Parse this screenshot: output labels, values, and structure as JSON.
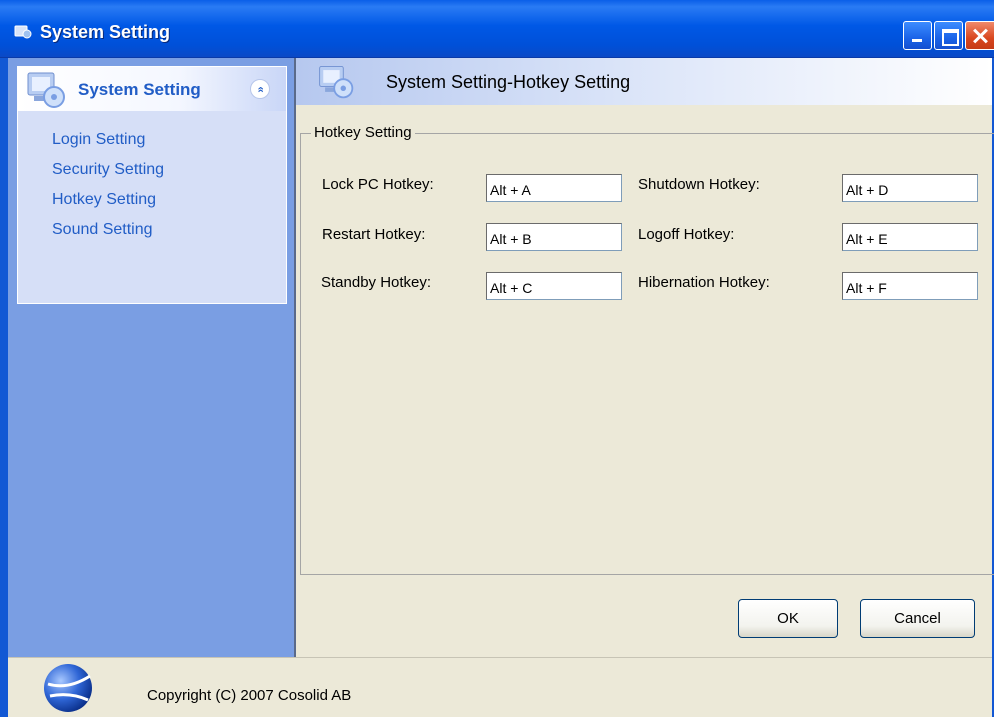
{
  "window": {
    "title": "System Setting",
    "icons": {
      "app": "app-icon",
      "minimize": "minimize-icon",
      "maximize": "maximize-icon",
      "close": "close-icon"
    }
  },
  "sidebar": {
    "header_title": "System Setting",
    "collapse_glyph": "«",
    "items": [
      {
        "label": "Login Setting"
      },
      {
        "label": "Security Setting"
      },
      {
        "label": "Hotkey Setting"
      },
      {
        "label": "Sound Setting"
      }
    ]
  },
  "content": {
    "header_title": "System Setting-Hotkey Setting",
    "group_title": "Hotkey Setting",
    "fields": {
      "lock_pc": {
        "label": "Lock PC Hotkey:",
        "value": "Alt + A"
      },
      "restart": {
        "label": "Restart Hotkey:",
        "value": "Alt + B"
      },
      "standby": {
        "label": "Standby Hotkey:",
        "value": "Alt + C"
      },
      "shutdown": {
        "label": "Shutdown Hotkey:",
        "value": "Alt + D"
      },
      "logoff": {
        "label": "Logoff Hotkey:",
        "value": "Alt + E"
      },
      "hibernation": {
        "label": "Hibernation Hotkey:",
        "value": "Alt + F"
      }
    },
    "buttons": {
      "ok": "OK",
      "cancel": "Cancel"
    }
  },
  "footer": {
    "copyright": "Copyright (C) 2007 Cosolid AB"
  },
  "colors": {
    "titlebar": "#0058e6",
    "sidebar_bg": "#7a9ee3",
    "sidebar_panel": "#d6dff7",
    "link": "#215dc6",
    "content_bg": "#ece9d8"
  }
}
